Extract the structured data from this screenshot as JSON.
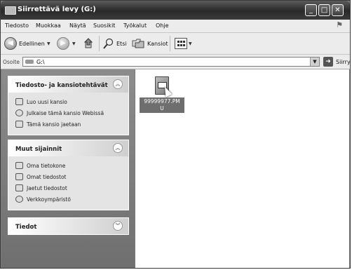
{
  "window": {
    "title": "Siirrettävä levy (G:)"
  },
  "menubar": {
    "items": [
      "Tiedosto",
      "Muokkaa",
      "Näytä",
      "Suosikit",
      "Työkalut",
      "Ohje"
    ]
  },
  "toolbar": {
    "back_label": "Edellinen",
    "search_label": "Etsi",
    "folders_label": "Kansiot"
  },
  "address": {
    "label": "Osoite",
    "value": "G:\\",
    "go_label": "Siirry"
  },
  "panels": {
    "tasks": {
      "title": "Tiedosto- ja kansiotehtävät",
      "links": [
        "Luo uusi kansio",
        "Julkaise tämä kansio Webissä",
        "Tämä kansio jaetaan"
      ]
    },
    "places": {
      "title": "Muut sijainnit",
      "links": [
        "Oma tietokone",
        "Omat tiedostot",
        "Jaetut tiedostot",
        "Verkkoympäristö"
      ]
    },
    "details": {
      "title": "Tiedot"
    }
  },
  "files": [
    {
      "name_line1": "99999977.PM",
      "name_line2": "U",
      "icon": "document-icon",
      "selected": true
    }
  ]
}
